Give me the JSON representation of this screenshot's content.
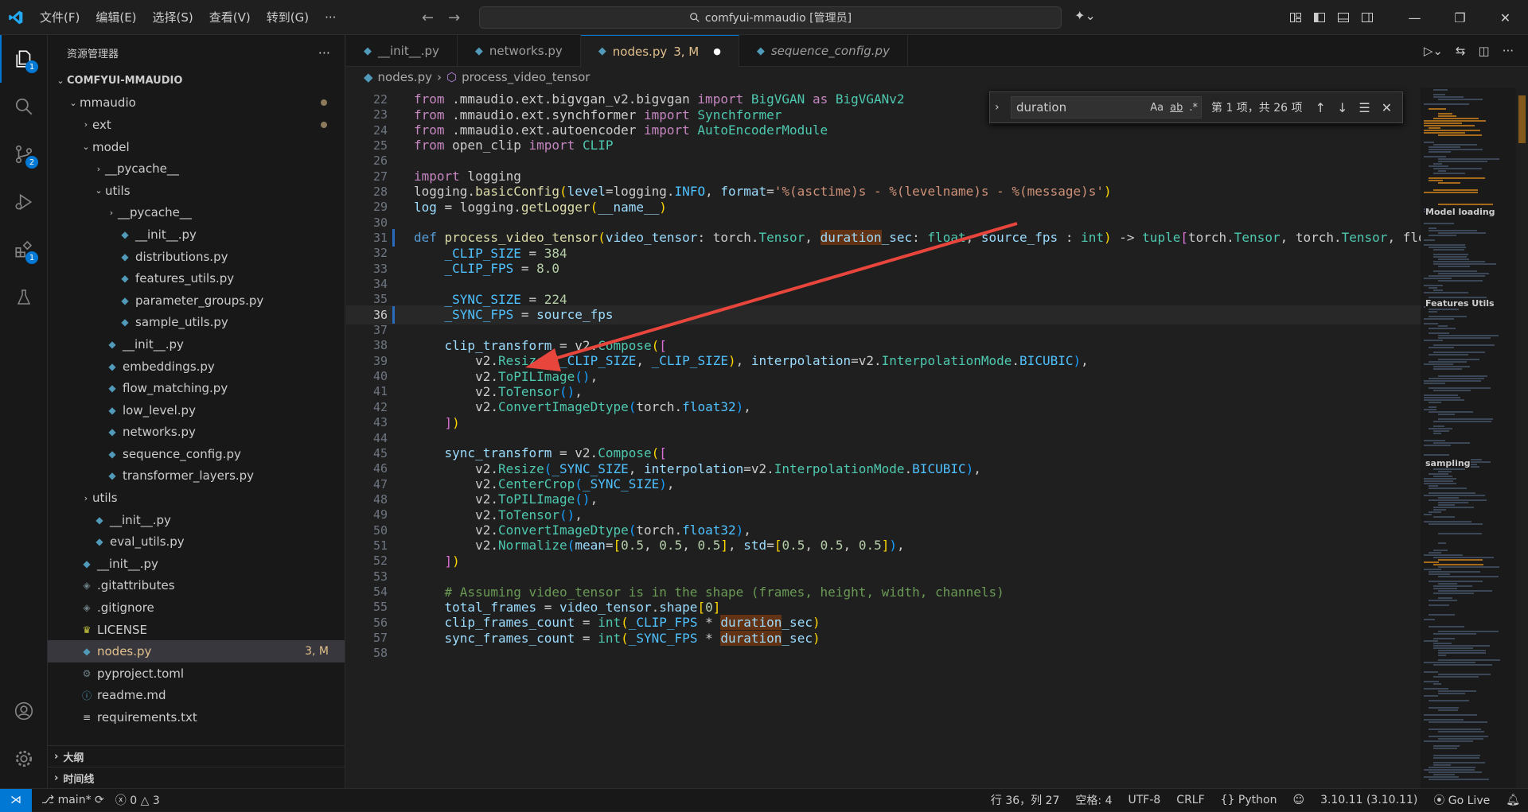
{
  "menu": [
    "文件(F)",
    "编辑(E)",
    "选择(S)",
    "查看(V)",
    "转到(G)",
    "···"
  ],
  "title": "comfyui-mmaudio [管理员]",
  "activity_badges": {
    "explorer": "1",
    "scm": "2",
    "extensions": "1"
  },
  "sidebar": {
    "title": "资源管理器",
    "more": "···",
    "rows": [
      {
        "label": "COMFYUI-MMAUDIO",
        "indent": 0,
        "chev": "⌄",
        "icon": "",
        "bold": true
      },
      {
        "label": "mmaudio",
        "indent": 1,
        "chev": "⌄",
        "icon": "",
        "dot": true
      },
      {
        "label": "ext",
        "indent": 2,
        "chev": "›",
        "icon": "",
        "dot": true
      },
      {
        "label": "model",
        "indent": 2,
        "chev": "⌄",
        "icon": ""
      },
      {
        "label": "__pycache__",
        "indent": 3,
        "chev": "›",
        "icon": ""
      },
      {
        "label": "utils",
        "indent": 3,
        "chev": "⌄",
        "icon": ""
      },
      {
        "label": "__pycache__",
        "indent": 4,
        "chev": "›",
        "icon": ""
      },
      {
        "label": "__init__.py",
        "indent": 4,
        "chev": "",
        "icon": "py"
      },
      {
        "label": "distributions.py",
        "indent": 4,
        "chev": "",
        "icon": "py"
      },
      {
        "label": "features_utils.py",
        "indent": 4,
        "chev": "",
        "icon": "py"
      },
      {
        "label": "parameter_groups.py",
        "indent": 4,
        "chev": "",
        "icon": "py"
      },
      {
        "label": "sample_utils.py",
        "indent": 4,
        "chev": "",
        "icon": "py"
      },
      {
        "label": "__init__.py",
        "indent": 3,
        "chev": "",
        "icon": "py"
      },
      {
        "label": "embeddings.py",
        "indent": 3,
        "chev": "",
        "icon": "py"
      },
      {
        "label": "flow_matching.py",
        "indent": 3,
        "chev": "",
        "icon": "py"
      },
      {
        "label": "low_level.py",
        "indent": 3,
        "chev": "",
        "icon": "py"
      },
      {
        "label": "networks.py",
        "indent": 3,
        "chev": "",
        "icon": "py"
      },
      {
        "label": "sequence_config.py",
        "indent": 3,
        "chev": "",
        "icon": "py"
      },
      {
        "label": "transformer_layers.py",
        "indent": 3,
        "chev": "",
        "icon": "py"
      },
      {
        "label": "utils",
        "indent": 2,
        "chev": "›",
        "icon": ""
      },
      {
        "label": "__init__.py",
        "indent": 2,
        "chev": "",
        "icon": "py"
      },
      {
        "label": "eval_utils.py",
        "indent": 2,
        "chev": "",
        "icon": "py"
      },
      {
        "label": "__init__.py",
        "indent": 1,
        "chev": "",
        "icon": "py"
      },
      {
        "label": ".gitattributes",
        "indent": 1,
        "chev": "",
        "icon": "git"
      },
      {
        "label": ".gitignore",
        "indent": 1,
        "chev": "",
        "icon": "git"
      },
      {
        "label": "LICENSE",
        "indent": 1,
        "chev": "",
        "icon": "lic"
      },
      {
        "label": "nodes.py",
        "indent": 1,
        "chev": "",
        "icon": "py",
        "selected": true,
        "badge": "3, M"
      },
      {
        "label": "pyproject.toml",
        "indent": 1,
        "chev": "",
        "icon": "gear"
      },
      {
        "label": "readme.md",
        "indent": 1,
        "chev": "",
        "icon": "info"
      },
      {
        "label": "requirements.txt",
        "indent": 1,
        "chev": "",
        "icon": "txt"
      }
    ],
    "outline": "大纲",
    "timeline": "时间线"
  },
  "tabs": [
    {
      "label": "__init__.py"
    },
    {
      "label": "networks.py"
    },
    {
      "label": "nodes.py",
      "mod": "3, M",
      "active": true
    },
    {
      "label": "sequence_config.py",
      "italic": true
    }
  ],
  "breadcrumb": {
    "file": "nodes.py",
    "symbol": "process_video_tensor"
  },
  "find": {
    "query": "duration",
    "count": "第 1 项，共 26 项",
    "opt_case": "Aa",
    "opt_word": "ab",
    "opt_regex": ".*"
  },
  "code": [
    {
      "n": "22",
      "html": "<span style='color:#c586c0'>from</span> .mmaudio.ext.bigvgan_v2.bigvgan <span style='color:#c586c0'>import</span> <span style='color:#4ec9b0'>BigVGAN</span> <span style='color:#c586c0'>as</span> <span style='color:#4ec9b0'>BigVGANv2</span>"
    },
    {
      "n": "23",
      "html": "<span style='color:#c586c0'>from</span> .mmaudio.ext.synchformer <span style='color:#c586c0'>import</span> <span style='color:#4ec9b0'>Synchformer</span>"
    },
    {
      "n": "24",
      "html": "<span style='color:#c586c0'>from</span> .mmaudio.ext.autoencoder <span style='color:#c586c0'>import</span> <span style='color:#4ec9b0'>AutoEncoderModule</span>"
    },
    {
      "n": "25",
      "html": "<span style='color:#c586c0'>from</span> open_clip <span style='color:#c586c0'>import</span> <span style='color:#4ec9b0'>CLIP</span>"
    },
    {
      "n": "26",
      "html": ""
    },
    {
      "n": "27",
      "html": "<span style='color:#c586c0'>import</span> logging"
    },
    {
      "n": "28",
      "html": "logging.<span style='color:#dcdcaa'>basicConfig</span><span style='color:#ffd700'>(</span><span style='color:#9cdcfe'>level</span>=logging.<span style='color:#4fc1ff'>INFO</span>, <span style='color:#9cdcfe'>format</span>=<span style='color:#ce9178'>'%(asctime)s - %(levelname)s - %(message)s'</span><span style='color:#ffd700'>)</span>"
    },
    {
      "n": "29",
      "html": "<span style='color:#9cdcfe'>log</span> = logging.<span style='color:#dcdcaa'>getLogger</span><span style='color:#ffd700'>(</span><span style='color:#9cdcfe'>__name__</span><span style='color:#ffd700'>)</span>"
    },
    {
      "n": "30",
      "html": ""
    },
    {
      "n": "31",
      "html": "<span style='color:#569cd6'>def</span> <span style='color:#dcdcaa'>process_video_tensor</span><span style='color:#ffd700'>(</span><span style='color:#9cdcfe'>video_tensor</span>: torch.<span style='color:#4ec9b0'>Tensor</span>, <span style='color:#9cdcfe;background:#613214'>duration</span><span style='color:#9cdcfe'>_sec</span>: <span style='color:#4ec9b0'>float</span>, <span style='color:#9cdcfe'>source_fps</span> : <span style='color:#4ec9b0'>int</span><span style='color:#ffd700'>)</span> -&gt; <span style='color:#4ec9b0'>tuple</span><span style='color:#da70d6'>[</span>torch.<span style='color:#4ec9b0'>Tensor</span>, torch.<span style='color:#4ec9b0'>Tensor</span>, flo",
      "mark": true
    },
    {
      "n": "32",
      "html": "    <span style='color:#4fc1ff'>_CLIP_SIZE</span> = <span style='color:#b5cea8'>384</span>"
    },
    {
      "n": "33",
      "html": "    <span style='color:#4fc1ff'>_CLIP_FPS</span> = <span style='color:#b5cea8'>8.0</span>"
    },
    {
      "n": "34",
      "html": ""
    },
    {
      "n": "35",
      "html": "    <span style='color:#4fc1ff'>_SYNC_SIZE</span> = <span style='color:#b5cea8'>224</span>"
    },
    {
      "n": "36",
      "html": "    <span style='color:#4fc1ff'>_SYNC_FPS</span> = <span style='color:#9cdcfe'>source_fps</span>",
      "mark": true,
      "cur": true
    },
    {
      "n": "37",
      "html": ""
    },
    {
      "n": "38",
      "html": "    <span style='color:#9cdcfe'>clip_transform</span> = v2.<span style='color:#4ec9b0'>Compose</span><span style='color:#ffd700'>(</span><span style='color:#da70d6'>[</span>"
    },
    {
      "n": "39",
      "html": "        v2.<span style='color:#4ec9b0'>Resize</span><span style='color:#179fff'>(</span><span style='color:#ffd700'>(</span><span style='color:#4fc1ff'>_CLIP_SIZE</span>, <span style='color:#4fc1ff'>_CLIP_SIZE</span><span style='color:#ffd700'>)</span>, <span style='color:#9cdcfe'>interpolation</span>=v2.<span style='color:#4ec9b0'>InterpolationMode</span>.<span style='color:#4fc1ff'>BICUBIC</span><span style='color:#179fff'>)</span>,"
    },
    {
      "n": "40",
      "html": "        v2.<span style='color:#4ec9b0'>ToPILImage</span><span style='color:#179fff'>()</span>,"
    },
    {
      "n": "41",
      "html": "        v2.<span style='color:#4ec9b0'>ToTensor</span><span style='color:#179fff'>()</span>,"
    },
    {
      "n": "42",
      "html": "        v2.<span style='color:#4ec9b0'>ConvertImageDtype</span><span style='color:#179fff'>(</span>torch.<span style='color:#4fc1ff'>float32</span><span style='color:#179fff'>)</span>,"
    },
    {
      "n": "43",
      "html": "    <span style='color:#da70d6'>]</span><span style='color:#ffd700'>)</span>"
    },
    {
      "n": "44",
      "html": ""
    },
    {
      "n": "45",
      "html": "    <span style='color:#9cdcfe'>sync_transform</span> = v2.<span style='color:#4ec9b0'>Compose</span><span style='color:#ffd700'>(</span><span style='color:#da70d6'>[</span>"
    },
    {
      "n": "46",
      "html": "        v2.<span style='color:#4ec9b0'>Resize</span><span style='color:#179fff'>(</span><span style='color:#4fc1ff'>_SYNC_SIZE</span>, <span style='color:#9cdcfe'>interpolation</span>=v2.<span style='color:#4ec9b0'>InterpolationMode</span>.<span style='color:#4fc1ff'>BICUBIC</span><span style='color:#179fff'>)</span>,"
    },
    {
      "n": "47",
      "html": "        v2.<span style='color:#4ec9b0'>CenterCrop</span><span style='color:#179fff'>(</span><span style='color:#4fc1ff'>_SYNC_SIZE</span><span style='color:#179fff'>)</span>,"
    },
    {
      "n": "48",
      "html": "        v2.<span style='color:#4ec9b0'>ToPILImage</span><span style='color:#179fff'>()</span>,"
    },
    {
      "n": "49",
      "html": "        v2.<span style='color:#4ec9b0'>ToTensor</span><span style='color:#179fff'>()</span>,"
    },
    {
      "n": "50",
      "html": "        v2.<span style='color:#4ec9b0'>ConvertImageDtype</span><span style='color:#179fff'>(</span>torch.<span style='color:#4fc1ff'>float32</span><span style='color:#179fff'>)</span>,"
    },
    {
      "n": "51",
      "html": "        v2.<span style='color:#4ec9b0'>Normalize</span><span style='color:#179fff'>(</span><span style='color:#9cdcfe'>mean</span>=<span style='color:#ffd700'>[</span><span style='color:#b5cea8'>0.5</span>, <span style='color:#b5cea8'>0.5</span>, <span style='color:#b5cea8'>0.5</span><span style='color:#ffd700'>]</span>, <span style='color:#9cdcfe'>std</span>=<span style='color:#ffd700'>[</span><span style='color:#b5cea8'>0.5</span>, <span style='color:#b5cea8'>0.5</span>, <span style='color:#b5cea8'>0.5</span><span style='color:#ffd700'>]</span><span style='color:#179fff'>)</span>,"
    },
    {
      "n": "52",
      "html": "    <span style='color:#da70d6'>]</span><span style='color:#ffd700'>)</span>"
    },
    {
      "n": "53",
      "html": ""
    },
    {
      "n": "54",
      "html": "    <span style='color:#6a9955'># Assuming video_tensor is in the shape (frames, height, width, channels)</span>"
    },
    {
      "n": "55",
      "html": "    <span style='color:#9cdcfe'>total_frames</span> = <span style='color:#9cdcfe'>video_tensor</span>.<span style='color:#9cdcfe'>shape</span><span style='color:#ffd700'>[</span><span style='color:#b5cea8'>0</span><span style='color:#ffd700'>]</span>"
    },
    {
      "n": "56",
      "html": "    <span style='color:#9cdcfe'>clip_frames_count</span> = <span style='color:#4ec9b0'>int</span><span style='color:#ffd700'>(</span><span style='color:#4fc1ff'>_CLIP_FPS</span> * <span style='color:#9cdcfe;background:#613214'>duration</span><span style='color:#9cdcfe'>_sec</span><span style='color:#ffd700'>)</span>"
    },
    {
      "n": "57",
      "html": "    <span style='color:#9cdcfe'>sync_frames_count</span> = <span style='color:#4ec9b0'>int</span><span style='color:#ffd700'>(</span><span style='color:#4fc1ff'>_SYNC_FPS</span> * <span style='color:#9cdcfe;background:#613214'>duration</span><span style='color:#9cdcfe'>_sec</span><span style='color:#ffd700'>)</span>"
    },
    {
      "n": "58",
      "html": ""
    }
  ],
  "minimap_labels": [
    "Model loading",
    "Features Utils",
    "sampling"
  ],
  "status": {
    "branch": "main*",
    "errors": "0",
    "warnings": "3",
    "position": "行 36，列 27",
    "spaces": "空格: 4",
    "encoding": "UTF-8",
    "eol": "CRLF",
    "language": "Python",
    "interpreter": "3.10.11 (3.10.11)",
    "golive": "Go Live"
  },
  "colors": {
    "accent": "#0078d4",
    "arrow": "#e8453c",
    "find_highlight": "#613214"
  }
}
